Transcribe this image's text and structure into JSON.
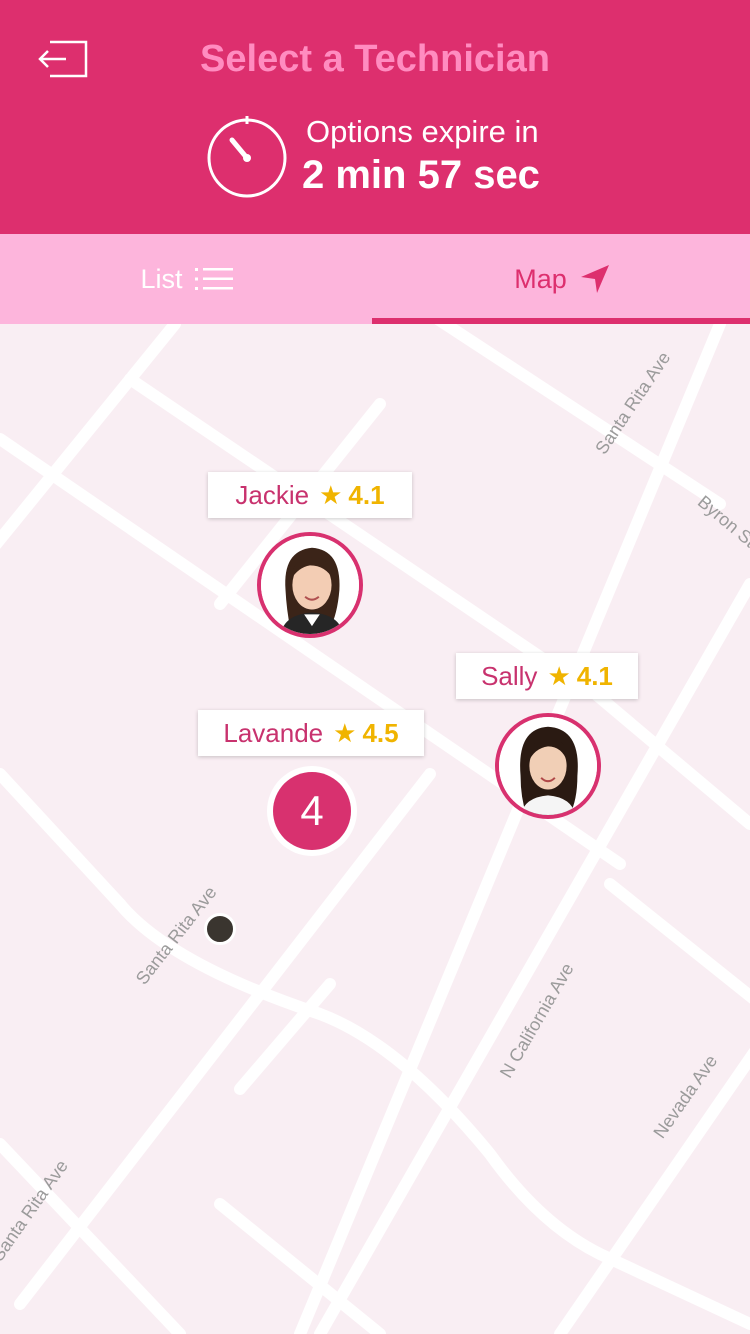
{
  "header": {
    "title": "Select a Technician",
    "expire_label": "Options expire in",
    "expire_value": "2 min 57 sec",
    "back_icon": "exit-arrow-icon",
    "timer_icon": "stopwatch-icon",
    "bg_color": "#dd2f6e",
    "title_color": "#ff8cc0"
  },
  "tabs": [
    {
      "label": "List",
      "icon": "list-icon",
      "active": false
    },
    {
      "label": "Map",
      "icon": "navigation-arrow-icon",
      "active": true
    }
  ],
  "map": {
    "streets": [
      "Santa Rita Ave",
      "Byron St",
      "Santa Rita Ave",
      "N California Ave",
      "Nevada Ave",
      "Santa Rita Ave"
    ],
    "technicians": [
      {
        "name": "Jackie",
        "rating": "4.1"
      },
      {
        "name": "Sally",
        "rating": "4.1"
      },
      {
        "name": "Lavande",
        "rating": "4.5"
      }
    ],
    "cluster_count": "4",
    "star_glyph": "★",
    "accent_color": "#d8316f",
    "rating_color": "#f0b400"
  }
}
